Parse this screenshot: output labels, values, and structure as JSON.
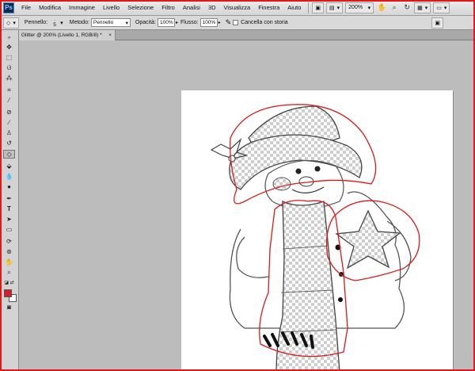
{
  "menubar": {
    "logo": "Ps",
    "items": [
      "File",
      "Modifica",
      "Immagine",
      "Livello",
      "Selezione",
      "Filtro",
      "Analisi",
      "3D",
      "Visualizza",
      "Finestra",
      "Aiuto"
    ],
    "zoom": "200%"
  },
  "options": {
    "brush_label": "Pennello:",
    "brush_size": "5",
    "method_label": "Metodo:",
    "method_value": "Pennello",
    "opacity_label": "Opacità:",
    "opacity_value": "100%",
    "flow_label": "Flusso:",
    "flow_value": "100%",
    "history_label": "Cancella con storia"
  },
  "tab": {
    "title": "Glitter @ 200% (Livello 1, RGB/8) *",
    "close": "×"
  },
  "colors": {
    "foreground": "#d4202a",
    "background": "#ffffff",
    "accent_red": "#e01818"
  }
}
